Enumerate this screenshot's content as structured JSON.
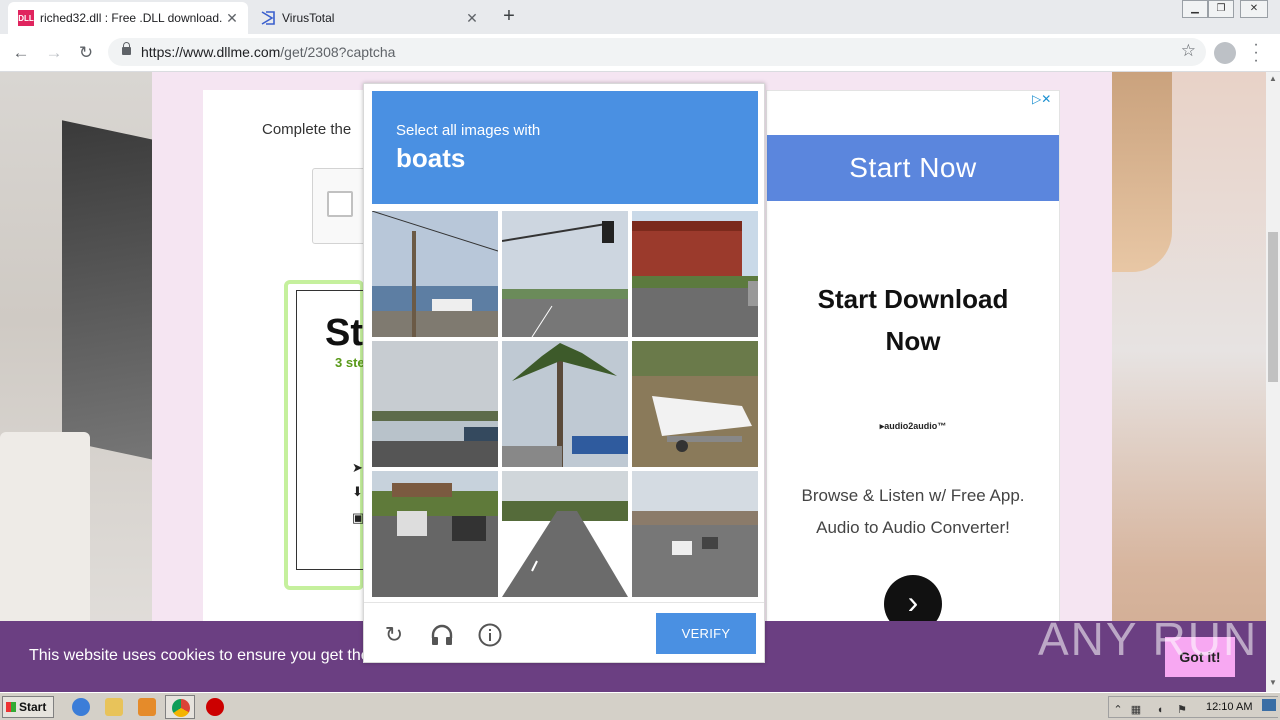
{
  "browser": {
    "tabs": [
      {
        "favicon": "DLL",
        "title": "riched32.dll : Free .DLL download. - ",
        "active": true
      },
      {
        "favicon": "virustotal-icon",
        "title": "VirusTotal",
        "active": false
      }
    ],
    "url_host": "https://www.dllme.com",
    "url_path": "/get/2308?captcha"
  },
  "page": {
    "complete_text": "Complete the",
    "step_title": "St",
    "step_sub": "3 ste"
  },
  "ad": {
    "button": "Start Now",
    "headline_line1": "Start Download",
    "headline_line2": "Now",
    "logo": "▸audio2audio™",
    "desc_line1": "Browse & Listen w/ Free App.",
    "desc_line2": "Audio to Audio Converter!"
  },
  "captcha": {
    "prompt": "Select all images with",
    "target": "boats",
    "verify_label": "VERIFY",
    "tiles": [
      "harbor-boats",
      "street-traffic-light",
      "red-building-street",
      "waterfront-road-truck",
      "palm-tree-marina",
      "boat-on-trailer",
      "highway-underpass-cars",
      "highway-road",
      "highway-bridge"
    ]
  },
  "cookie": {
    "text": "This website uses cookies to ensure you get the",
    "button": "Got it!"
  },
  "watermark": "ANY RUN",
  "taskbar": {
    "start": "Start",
    "clock": "12:10 AM"
  }
}
